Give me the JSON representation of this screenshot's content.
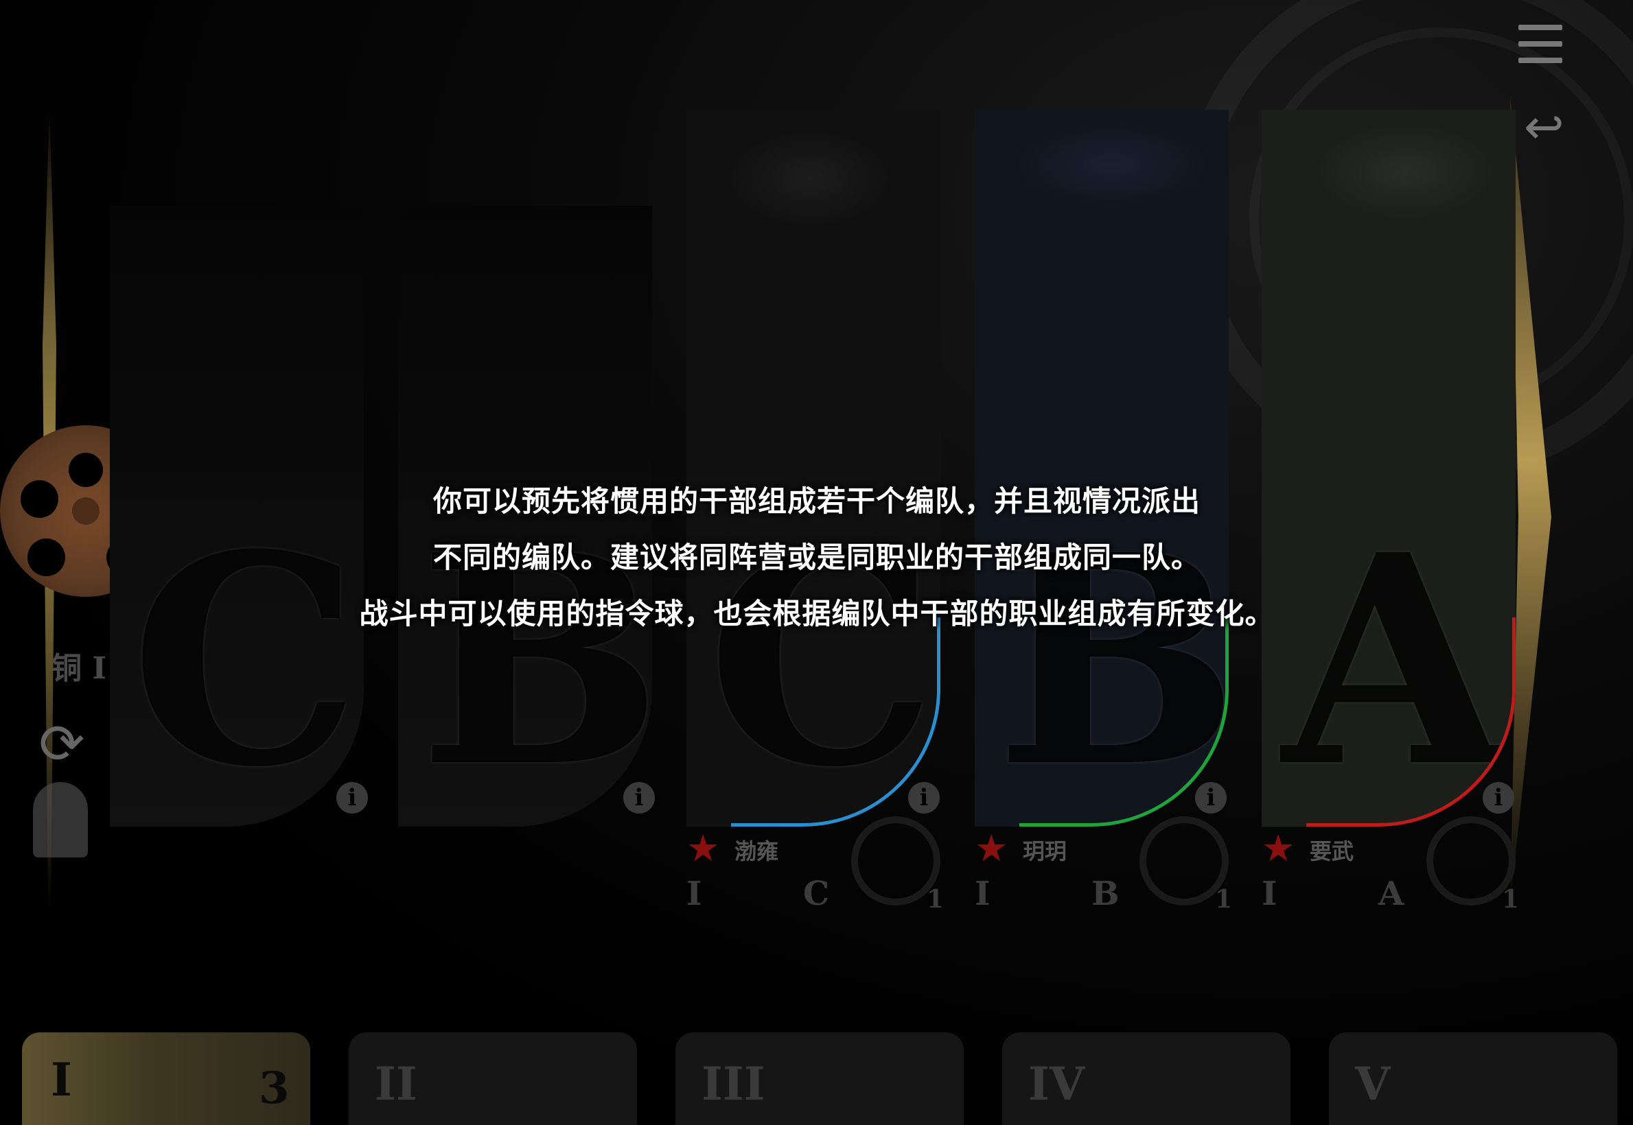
{
  "message": {
    "lines": [
      "你可以预先将惯用的干部组成若干个编队，并且视情况派出",
      "不同的编队。建议将同阵营或是同职业的干部组成同一队。",
      "战斗中可以使用的指令球，也会根据编队中干部的职业组成有所变化。"
    ]
  },
  "sidebar": {
    "rank_label": "铜 I",
    "rank_icon": "gear-disc-icon",
    "sync_icon": "sync-icon",
    "soldier_icon": "soldier-icon"
  },
  "top_right": {
    "menu_icon": "menu-icon",
    "back_icon": "back-arrow-icon"
  },
  "slots": [
    {
      "letter": "C",
      "info": "i",
      "name": "",
      "stats": [
        "",
        "",
        ""
      ],
      "accent": "",
      "filled": false
    },
    {
      "letter": "B",
      "info": "i",
      "name": "",
      "stats": [
        "",
        "",
        ""
      ],
      "accent": "",
      "filled": false
    },
    {
      "letter": "C",
      "info": "i",
      "name": "渤雍",
      "stats": [
        "I",
        "C",
        "1"
      ],
      "accent": "#2a8fd0",
      "filled": true,
      "portrait": "officer-masked"
    },
    {
      "letter": "B",
      "info": "i",
      "name": "玥玥",
      "stats": [
        "I",
        "B",
        "1"
      ],
      "accent": "#1fa43a",
      "filled": true,
      "portrait": "policewoman"
    },
    {
      "letter": "A",
      "info": "i",
      "name": "要武",
      "stats": [
        "I",
        "A",
        "1"
      ],
      "accent": "#c01a1a",
      "filled": true,
      "portrait": "soldier-smiling"
    }
  ],
  "tabs": [
    {
      "label": "I",
      "count": "3",
      "active": true
    },
    {
      "label": "II",
      "count": "",
      "active": false
    },
    {
      "label": "III",
      "count": "",
      "active": false
    },
    {
      "label": "IV",
      "count": "",
      "active": false
    },
    {
      "label": "V",
      "count": "",
      "active": false
    }
  ],
  "colors": {
    "background": "#000000",
    "active_tab": "#5d5330",
    "faction_star": "#8a1010"
  }
}
